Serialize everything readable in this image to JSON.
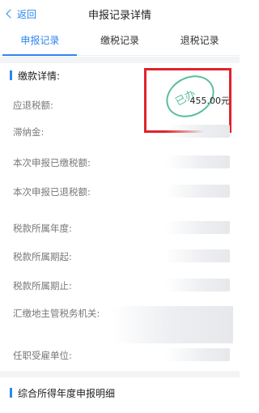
{
  "nav": {
    "back_label": "返回",
    "title": "申报记录详情"
  },
  "tabs": [
    {
      "label": "申报记录",
      "active": true
    },
    {
      "label": "缴税记录",
      "active": false
    },
    {
      "label": "退税记录",
      "active": false
    }
  ],
  "payment_section": {
    "heading": "缴款详情:",
    "refund_amount": "455.00元",
    "stamp_text": "已办",
    "rows": [
      {
        "label": "应退税额:"
      },
      {
        "label": "滞纳金:"
      },
      {
        "label": "本次申报已缴税额:"
      },
      {
        "label": "本次申报已退税额:"
      },
      {
        "label": "税款所属年度:"
      },
      {
        "label": "税款所属期起:"
      },
      {
        "label": "税款所属期止:"
      },
      {
        "label": "汇缴地主管税务机关:"
      },
      {
        "label": "任职受雇单位:"
      }
    ]
  },
  "detail_section": {
    "heading": "综合所得年度申报明细"
  },
  "colors": {
    "accent": "#2d86f0",
    "highlight_box": "#e0232b",
    "stamp": "#3cb48a"
  }
}
